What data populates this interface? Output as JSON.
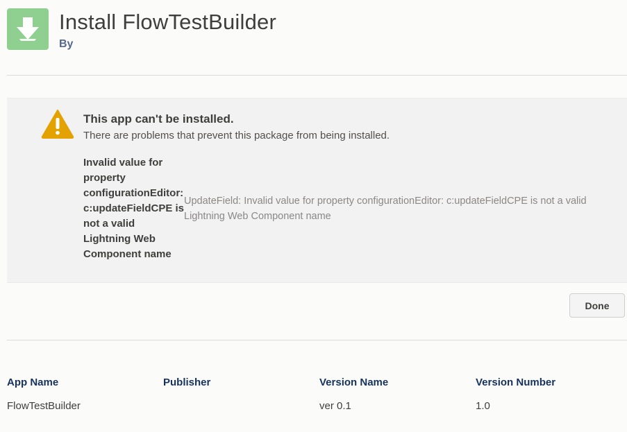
{
  "header": {
    "title": "Install FlowTestBuilder",
    "subtitle": "By"
  },
  "error": {
    "title": "This app can't be installed.",
    "description": "There are problems that prevent this package from being installed.",
    "code": "Invalid value for property configurationEditor: c:updateFieldCPE is not a valid Lightning Web Component name",
    "detail": "UpdateField: Invalid value for property configurationEditor: c:updateFieldCPE is not a valid Lightning Web Component name"
  },
  "actions": {
    "done_label": "Done"
  },
  "table": {
    "headers": [
      "App Name",
      "Publisher",
      "Version Name",
      "Version Number"
    ],
    "rows": [
      [
        "FlowTestBuilder",
        "",
        "ver 0.1",
        "1.0"
      ]
    ]
  },
  "colors": {
    "app_icon_bg": "#8fcf8f",
    "warning": "#e4a201",
    "header_text": "#16325c"
  },
  "icons": {
    "app": "download-arrow-icon",
    "warning": "warning-icon"
  }
}
